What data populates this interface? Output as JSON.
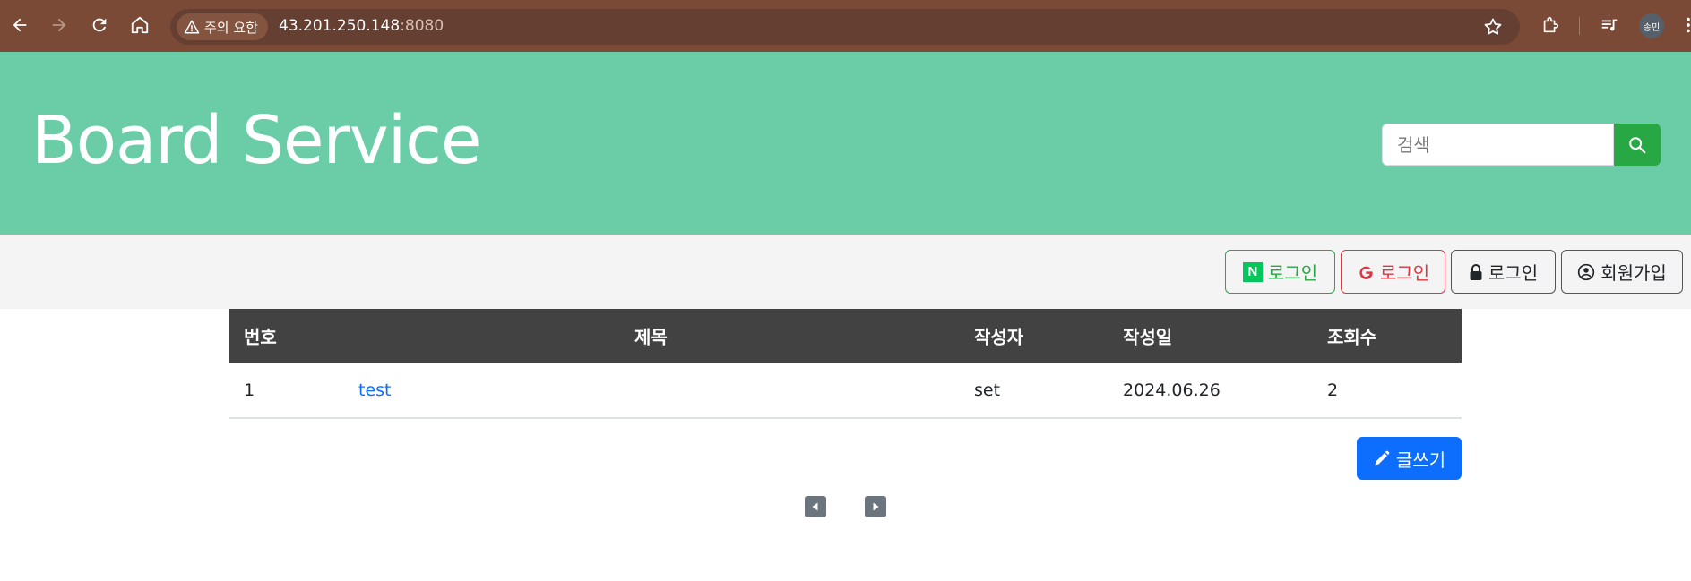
{
  "browser": {
    "security_chip": "주의 요함",
    "url_host": "43.201.250.148",
    "url_port": ":8080",
    "profile_label": "송민"
  },
  "header": {
    "title": "Board Service",
    "search_placeholder": "검색"
  },
  "auth": {
    "naver_login": "로그인",
    "google_login": "로그인",
    "local_login": "로그인",
    "signup": "회원가입"
  },
  "table": {
    "columns": [
      "번호",
      "제목",
      "작성자",
      "작성일",
      "조회수"
    ],
    "rows": [
      {
        "num": "1",
        "title": "test",
        "author": "set",
        "date": "2024.06.26",
        "views": "2"
      }
    ]
  },
  "actions": {
    "write": "글쓰기"
  },
  "colors": {
    "header_bg": "#6bcda8",
    "search_button": "#28a745",
    "naver": "#28a745",
    "google": "#dc3545",
    "primary": "#0d6efd",
    "table_header": "#424242"
  }
}
